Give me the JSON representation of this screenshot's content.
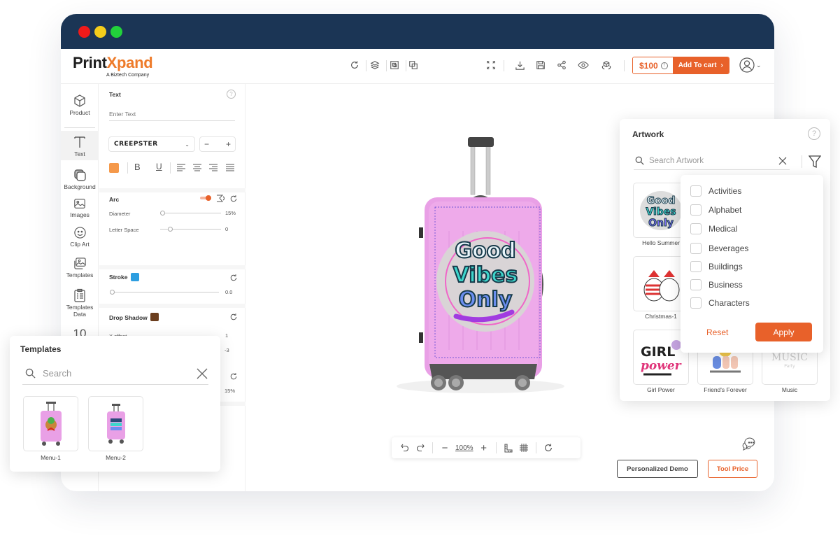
{
  "window": {
    "traffic_lights": [
      "close",
      "minimize",
      "maximize"
    ]
  },
  "header": {
    "logo_primary": "Print",
    "logo_accent": "Xpand",
    "logo_tagline": "A Biztech Company",
    "toolbar_icons": [
      "refresh-icon",
      "layers-icon",
      "group-icon",
      "duplicate-icon",
      "fullscreen-icon",
      "download-icon",
      "save-icon",
      "share-icon",
      "preview-icon",
      "3d-view-icon"
    ],
    "price": "$100",
    "add_to_cart": "Add To cart",
    "user_icon": "user-avatar-icon"
  },
  "sidebar": {
    "items": [
      {
        "label": "Product",
        "icon": "cube-icon"
      },
      {
        "label": "Text",
        "icon": "text-icon",
        "active": true
      },
      {
        "label": "Background",
        "icon": "background-icon"
      },
      {
        "label": "Images",
        "icon": "image-icon"
      },
      {
        "label": "Clip Art",
        "icon": "smiley-icon"
      },
      {
        "label": "Templates",
        "icon": "templates-icon"
      },
      {
        "label": "Templates Data",
        "icon": "clipboard-icon"
      },
      {
        "label": "10",
        "icon": "number-icon"
      }
    ]
  },
  "text_panel": {
    "title": "Text",
    "input_placeholder": "Enter Text",
    "font_name": "CREEPSTER",
    "minus": "−",
    "plus": "+",
    "color": "#f5994a",
    "bold": "B",
    "underline": "U",
    "arc": {
      "label": "Arc",
      "enabled": true,
      "diameter_label": "Diameter",
      "diameter_value": "15%",
      "letter_space_label": "Letter Space",
      "letter_space_value": "0"
    },
    "stroke": {
      "label": "Stroke",
      "color": "#2d9ee0",
      "value": "0.0"
    },
    "drop_shadow": {
      "label": "Drop Shadow",
      "color": "#6b3e1e",
      "x_offset_label": "X offset",
      "x_offset_value": "1",
      "y_offset_value": "-3",
      "opacity_value": "15%"
    }
  },
  "canvas": {
    "product": "Pink suitcase",
    "artwork_text": "Good Vibes Only",
    "zoom_level": "100%",
    "personalized_demo": "Personalized Demo",
    "tool_price": "Tool Price"
  },
  "templates_panel": {
    "title": "Templates",
    "search_placeholder": "Search",
    "items": [
      {
        "label": "Menu-1"
      },
      {
        "label": "Menu-2"
      }
    ]
  },
  "artwork_panel": {
    "title": "Artwork",
    "search_placeholder": "Search Artwork",
    "items": [
      {
        "label": "Hello Summer"
      },
      {
        "label": "Christmas-1"
      },
      {
        "label": "Girl Power"
      },
      {
        "label": "Friend's Forever"
      },
      {
        "label": "Music"
      }
    ],
    "filter": {
      "categories": [
        "Activities",
        "Alphabet",
        "Medical",
        "Beverages",
        "Buildings",
        "Business",
        "Characters"
      ],
      "reset": "Reset",
      "apply": "Apply"
    }
  },
  "colors": {
    "accent": "#e8612a",
    "titlebar": "#1b3555",
    "suitcase": "#e9a0e6"
  }
}
